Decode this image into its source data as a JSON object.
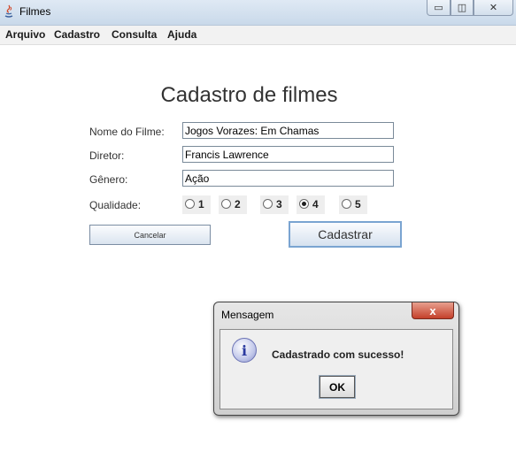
{
  "window": {
    "title": "Filmes",
    "minimize": "▭",
    "maximize": "◫",
    "close": "✕"
  },
  "menu": [
    "Arquivo",
    "Cadastro",
    "Consulta",
    "Ajuda"
  ],
  "form": {
    "title": "Cadastro de filmes",
    "labels": {
      "name": "Nome do Filme:",
      "director": "Diretor:",
      "genre": "Gênero:",
      "quality": "Qualidade:"
    },
    "values": {
      "name": "Jogos Vorazes: Em Chamas",
      "director": "Francis Lawrence",
      "genre": "Ação"
    },
    "quality_options": [
      "1",
      "2",
      "3",
      "4",
      "5"
    ],
    "quality_selected": "4",
    "cancel_label": "Cancelar",
    "save_label": "Cadastrar"
  },
  "dialog": {
    "title": "Mensagem",
    "close": "x",
    "icon_glyph": "i",
    "message": "Cadastrado com sucesso!",
    "ok_label": "OK"
  }
}
